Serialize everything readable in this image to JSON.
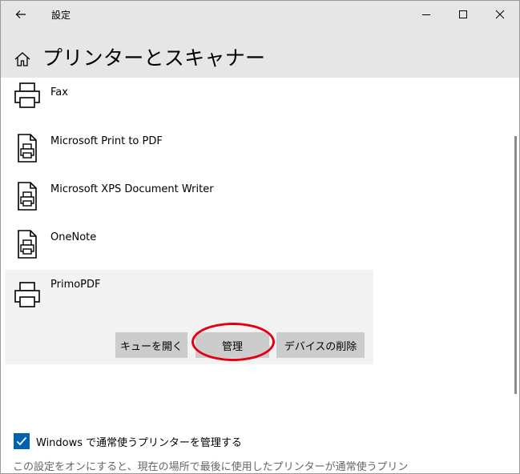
{
  "window": {
    "title": "設定",
    "back_icon": "arrow-left-icon",
    "controls": [
      "minimize-icon",
      "maximize-icon",
      "close-icon"
    ]
  },
  "header": {
    "icon": "home-icon",
    "title": "プリンターとスキャナー"
  },
  "printers": [
    {
      "name": "Fax",
      "icon": "printer-icon"
    },
    {
      "name": "Microsoft Print to PDF",
      "icon": "document-printer-icon"
    },
    {
      "name": "Microsoft XPS Document Writer",
      "icon": "document-printer-icon"
    },
    {
      "name": "OneNote",
      "icon": "document-printer-icon"
    },
    {
      "name": "PrimoPDF",
      "icon": "printer-icon",
      "selected": true
    }
  ],
  "selected_actions": {
    "open_queue": "キューを開く",
    "manage": "管理",
    "remove_device": "デバイスの削除"
  },
  "options": {
    "manage_default_label": "Windows で通常使うプリンターを管理する",
    "manage_default_checked": true,
    "description": "この設定をオンにすると、現在の場所で最後に使用したプリンターが通常使うプリン"
  },
  "colors": {
    "accent": "#0063b1",
    "header_bg": "#e6e6e6",
    "selected_bg": "#f2f2f2",
    "button_bg": "#cccccc",
    "highlight": "#e3000f"
  }
}
